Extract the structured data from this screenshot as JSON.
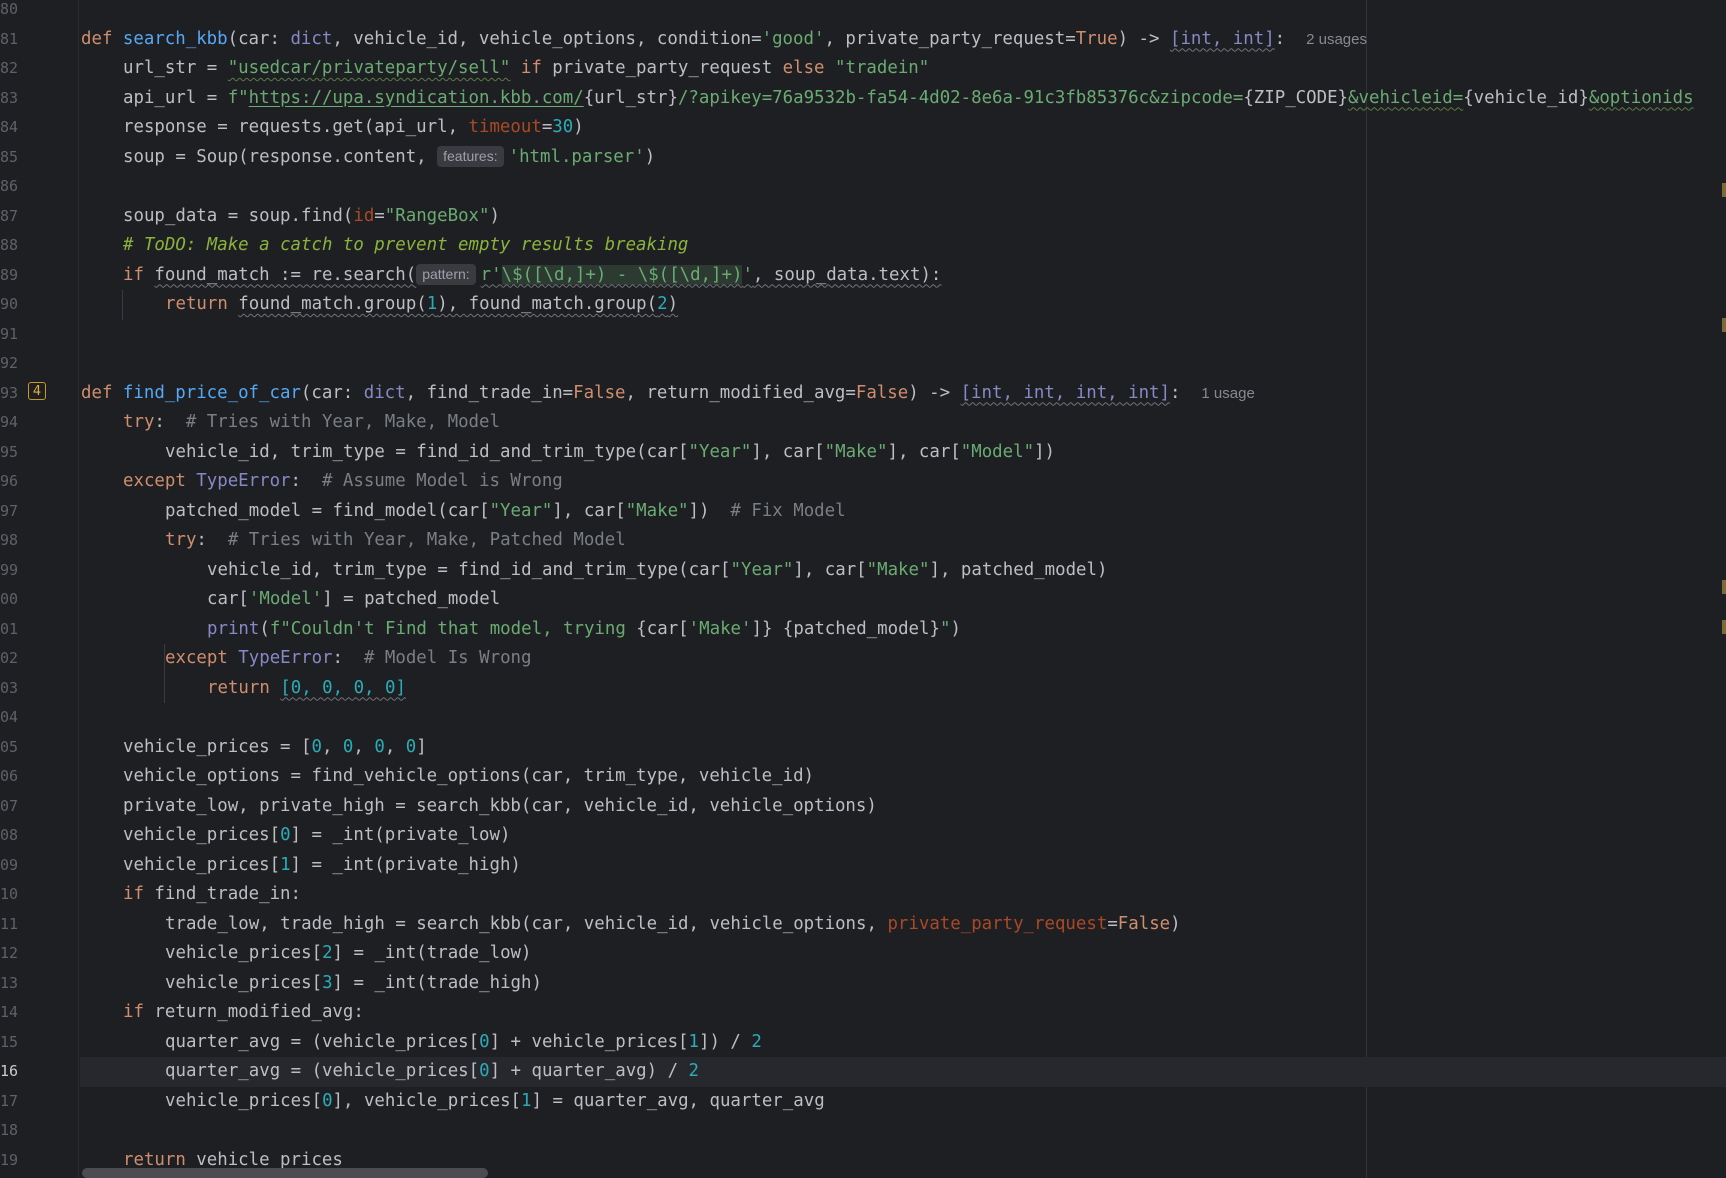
{
  "editor": {
    "line_numbers": [
      "80",
      "81",
      "82",
      "83",
      "84",
      "85",
      "86",
      "87",
      "88",
      "89",
      "90",
      "91",
      "92",
      "93",
      "94",
      "95",
      "96",
      "97",
      "98",
      "99",
      "00",
      "01",
      "02",
      "03",
      "04",
      "05",
      "06",
      "07",
      "08",
      "09",
      "10",
      "11",
      "12",
      "13",
      "14",
      "15",
      "16",
      "17",
      "18",
      "19"
    ],
    "current_line": "16",
    "warning_badge_count": "4",
    "usages_search_kbb": "2 usages",
    "usages_find_price": "1 usage",
    "inlay_features": "features:",
    "inlay_pattern": "pattern:"
  },
  "code": {
    "l81": {
      "def": "def",
      "name": "search_kbb",
      "p1": "(car: ",
      "t1": "dict",
      "p2": ", vehicle_id, vehicle_options, condition=",
      "s1": "'good'",
      "p3": ", private_party_request=",
      "k1": "True",
      "p4": ") -> ",
      "ret": "[int, int]",
      "colon": ":"
    },
    "l82": {
      "a": "url_str = ",
      "s1": "\"usedcar/privateparty/sell\"",
      "k1": " if ",
      "b": "private_party_request",
      "k2": " else ",
      "s2": "\"tradein\""
    },
    "l83": {
      "a": "api_url = ",
      "f": "f\"",
      "url": "https://upa.syndication.kbb.com/",
      "b": "{url_str}",
      "s1": "/?apikey=76a9532b-fa54-4d02-8e6a-91c3fb85376c&zipcode=",
      "c": "{ZIP_CODE}",
      "s2": "&vehicleid=",
      "d": "{vehicle_id}",
      "s3": "&optionids"
    },
    "l84": {
      "a": "response = requests.get(api_url, ",
      "kw": "timeout",
      "eq": "=",
      "n": "30",
      "c": ")"
    },
    "l85": {
      "a": "soup = Soup(response.content, ",
      "s1": "'html.parser'",
      "c": ")"
    },
    "l87": {
      "a": "soup_data = soup.find(",
      "kw": "id",
      "eq": "=",
      "s1": "\"RangeBox\"",
      "c": ")"
    },
    "l88": {
      "hash": "# ",
      "todo": "ToDO: Make a catch to prevent empty results breaking"
    },
    "l89": {
      "k": "if ",
      "a": "found_match := re.search(",
      "r": "r'",
      "rx": "\\$([\\d,]+) - \\$([\\d,]+)",
      "q": "'",
      "b": ", soup_data.text):"
    },
    "l90": {
      "k": "return ",
      "a": "found_match.group(",
      "n1": "1",
      "b": "), found_match.group(",
      "n2": "2",
      "c": ")"
    },
    "l93": {
      "def": "def",
      "name": "find_price_of_car",
      "p1": "(car: ",
      "t1": "dict",
      "p2": ", find_trade_in=",
      "k1": "False",
      "p3": ", return_modified_avg=",
      "k2": "False",
      "p4": ") -> ",
      "ret": "[int, int, int, int]",
      "colon": ":"
    },
    "l94": {
      "k": "try",
      "c": ":",
      "cm": "  # Tries with Year, Make, Model"
    },
    "l95": {
      "a": "vehicle_id, trim_type = find_id_and_trim_type(car[",
      "s1": "\"Year\"",
      "b": "], car[",
      "s2": "\"Make\"",
      "c": "], car[",
      "s3": "\"Model\"",
      "d": "])"
    },
    "l96": {
      "k": "except ",
      "t": "TypeError",
      "c": ":",
      "cm": "  # Assume Model is Wrong"
    },
    "l97": {
      "a": "patched_model = find_model(car[",
      "s1": "\"Year\"",
      "b": "], car[",
      "s2": "\"Make\"",
      "c": "])",
      "cm": "  # Fix Model"
    },
    "l98": {
      "k": "try",
      "c": ":",
      "cm": "  # Tries with Year, Make, Patched Model"
    },
    "l99": {
      "a": "vehicle_id, trim_type = find_id_and_trim_type(car[",
      "s1": "\"Year\"",
      "b": "], car[",
      "s2": "\"Make\"",
      "c": "], patched_model)"
    },
    "l100": {
      "a": "car[",
      "s1": "'Model'",
      "b": "] = patched_model"
    },
    "l101": {
      "bi": "print",
      "a": "(",
      "s1": "f\"Couldn't Find that model, trying ",
      "b": "{car[",
      "s2": "'Make'",
      "c": "]}",
      "s3": " ",
      "d": "{patched_model}",
      "s4": "\"",
      "e": ")"
    },
    "l102": {
      "k": "except ",
      "t": "TypeError",
      "c": ":",
      "cm": "  # Model Is Wrong"
    },
    "l103": {
      "k": "return ",
      "list": "[0, 0, 0, 0]"
    },
    "l105": {
      "a": "vehicle_prices = [",
      "n1": "0",
      "s": ", ",
      "n2": "0",
      "n3": "0",
      "n4": "0",
      "c": "]"
    },
    "l106": {
      "a": "vehicle_options = find_vehicle_options(car, trim_type, vehicle_id)"
    },
    "l107": {
      "a": "private_low, private_high = search_kbb(car, vehicle_id, vehicle_options)"
    },
    "l108": {
      "a": "vehicle_prices[",
      "n": "0",
      "b": "] = _int(private_low)"
    },
    "l109": {
      "a": "vehicle_prices[",
      "n": "1",
      "b": "] = _int(private_high)"
    },
    "l110": {
      "k": "if ",
      "a": "find_trade_in:"
    },
    "l111": {
      "a": "trade_low, trade_high = search_kbb(car, vehicle_id, vehicle_options, ",
      "kw": "private_party_request",
      "eq": "=",
      "k": "False",
      "c": ")"
    },
    "l112": {
      "a": "vehicle_prices[",
      "n": "2",
      "b": "] = _int(trade_low)"
    },
    "l113": {
      "a": "vehicle_prices[",
      "n": "3",
      "b": "] = _int(trade_high)"
    },
    "l114": {
      "k": "if ",
      "a": "return_modified_avg:"
    },
    "l115": {
      "a": "quarter_avg = (vehicle_prices[",
      "n1": "0",
      "b": "] + vehicle_prices[",
      "n2": "1",
      "c": "]) / ",
      "n3": "2"
    },
    "l116": {
      "a": "quarter_avg = (vehicle_prices[",
      "n1": "0",
      "b": "] + quarter_avg) / ",
      "n2": "2"
    },
    "l117": {
      "a": "vehicle_prices[",
      "n1": "0",
      "b": "], vehicle_prices[",
      "n2": "1",
      "c": "] = quarter_avg, quarter_avg"
    },
    "l119": {
      "k": "return ",
      "a": "vehicle_prices"
    }
  },
  "colors": {
    "background": "#1e1f22",
    "keyword": "#cf8e6d",
    "function": "#56a8f5",
    "string": "#6aab73",
    "number": "#2aacb8",
    "comment": "#7a7e85",
    "todo": "#8bb33d"
  }
}
